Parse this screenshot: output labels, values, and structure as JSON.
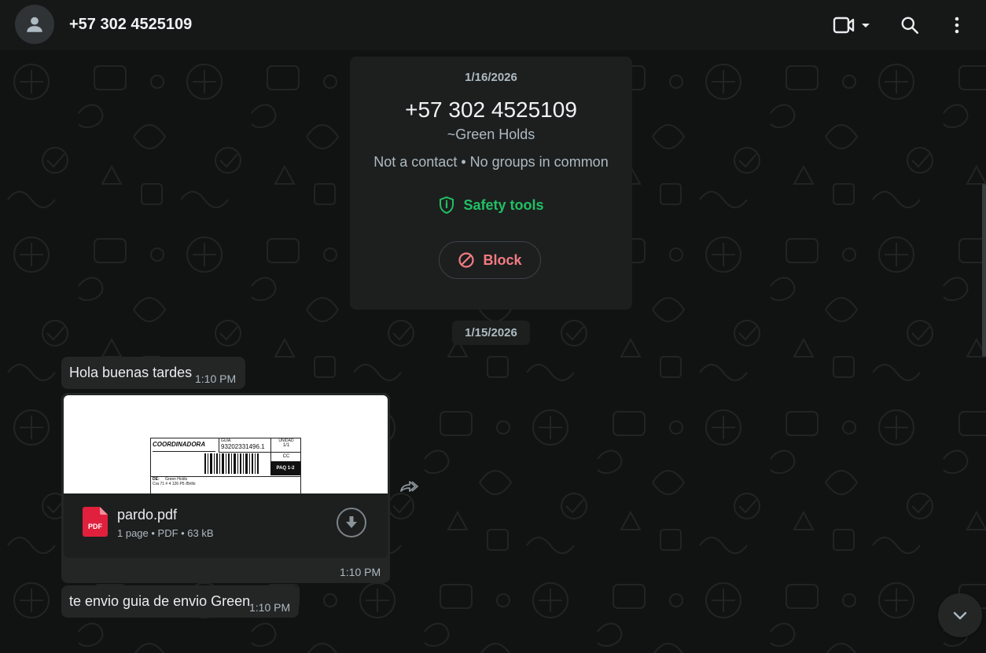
{
  "header": {
    "contact_name": "+57 302 4525109"
  },
  "info_card": {
    "date": "1/16/2026",
    "phone": "+57 302 4525109",
    "alias": "~Green Holds",
    "note": "Not a contact • No groups in common",
    "safety_label": "Safety tools",
    "block_label": "Block"
  },
  "date_chip": "1/15/2026",
  "messages": [
    {
      "text": "Hola buenas tardes",
      "time": "1:10 PM"
    },
    {
      "type": "document",
      "file_name": "pardo.pdf",
      "meta": "1 page • PDF • 63 kB",
      "time": "1:10 PM",
      "preview": {
        "brand": "COORDINADORA",
        "guia_label": "GUIA:",
        "guia_number": "93202331496.1",
        "unidad_label": "UNIDAD",
        "unidad_value": "1/1",
        "cc": "CC",
        "paq": "PAQ 1-2",
        "de_label": "DE:",
        "de_name": "Green Holds",
        "address": "Cra 71 # 4 126 P5 /Brillo"
      }
    },
    {
      "text": "te envio guia de envio Green",
      "time": "1:10 PM"
    }
  ],
  "icons": {
    "avatar": "person-icon",
    "video": "video-camera-icon",
    "search": "search-icon",
    "menu": "more-vertical-icon",
    "safety": "shield-icon",
    "block": "block-icon",
    "pdf": "pdf-file-icon",
    "download": "download-icon",
    "forward": "forward-icon",
    "scroll": "chevron-down-icon"
  },
  "colors": {
    "accent_green": "#21c063",
    "block_red": "#f47b82",
    "bubble": "#242626",
    "header": "#161717"
  }
}
